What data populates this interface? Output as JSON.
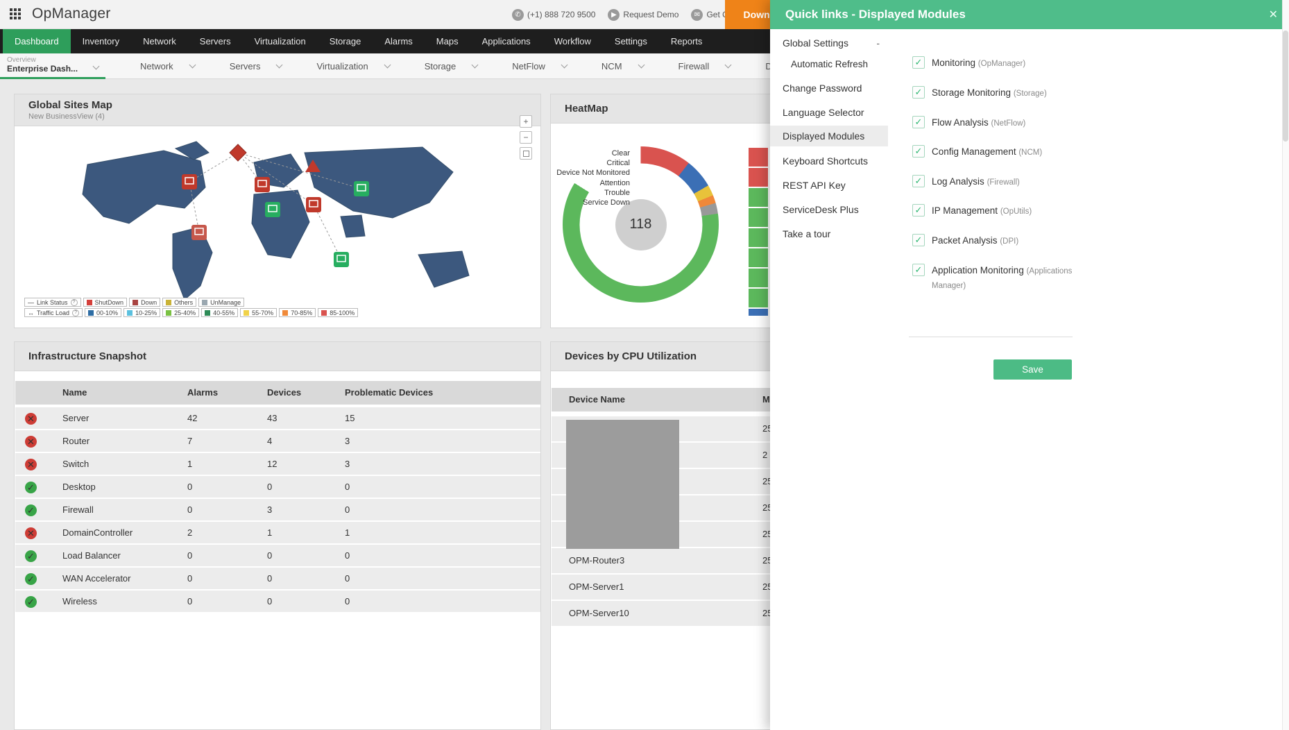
{
  "topbar": {
    "logo": "OpManager",
    "phone": "(+1) 888 720 9500",
    "request_demo": "Request Demo",
    "get_quote": "Get Quote",
    "download_label": "Download"
  },
  "nav": {
    "items": [
      {
        "label": "Dashboard"
      },
      {
        "label": "Inventory"
      },
      {
        "label": "Network"
      },
      {
        "label": "Servers"
      },
      {
        "label": "Virtualization"
      },
      {
        "label": "Storage"
      },
      {
        "label": "Alarms"
      },
      {
        "label": "Maps"
      },
      {
        "label": "Applications"
      },
      {
        "label": "Workflow"
      },
      {
        "label": "Settings"
      },
      {
        "label": "Reports"
      }
    ]
  },
  "subnav": {
    "overview": "Overview",
    "dashboard_name": "Enterprise Dash...",
    "items": [
      "Network",
      "Servers",
      "Virtualization",
      "Storage",
      "NetFlow",
      "NCM",
      "Firewall",
      "DPI"
    ]
  },
  "map_card": {
    "title": "Global Sites Map",
    "subtitle": "New BusinessView (4)",
    "zoom_in": "+",
    "zoom_out": "−",
    "help": "?",
    "legend": {
      "link_status": "Link Status",
      "link_symbol": "—",
      "traffic_symbol": "↔",
      "link_items": [
        {
          "label": "ShutDown",
          "color": "#d43f3a"
        },
        {
          "label": "Down",
          "color": "#a94442"
        },
        {
          "label": "Others",
          "color": "#c9b237"
        },
        {
          "label": "UnManage",
          "color": "#9aa7b0"
        }
      ],
      "traffic_load": "Traffic Load",
      "traffic_items": [
        {
          "label": "00-10%",
          "color": "#2e6da4"
        },
        {
          "label": "10-25%",
          "color": "#5bc0de"
        },
        {
          "label": "25-40%",
          "color": "#7ac143"
        },
        {
          "label": "40-55%",
          "color": "#2e8b57"
        },
        {
          "label": "55-70%",
          "color": "#f0d24a"
        },
        {
          "label": "70-85%",
          "color": "#f08a3a"
        },
        {
          "label": "85-100%",
          "color": "#d9534f"
        }
      ]
    }
  },
  "heatmap_card": {
    "title": "HeatMap",
    "center_value": "118",
    "chart_data": {
      "type": "pie",
      "labels": [
        "Clear",
        "Critical",
        "Device Not Monitored",
        "Attention",
        "Trouble",
        "Service Down"
      ],
      "approx_percent": [
        75,
        11,
        6,
        2,
        2,
        2
      ],
      "colors": [
        "#5cb85c",
        "#d9534f",
        "#3b6fb5",
        "#e8c23a",
        "#f0883a",
        "#999999"
      ],
      "total": 118
    },
    "cells": [
      "#d9534f",
      "#d9534f",
      "#5cb85c",
      "#5cb85c",
      "#5cb85c",
      "#5cb85c",
      "#5cb85c",
      "#5cb85c",
      "#3b6fb5"
    ]
  },
  "infra_card": {
    "title": "Infrastructure Snapshot",
    "columns": [
      "Name",
      "Alarms",
      "Devices",
      "Problematic Devices"
    ],
    "rows": [
      {
        "status": "error",
        "name": "Server",
        "alarms": "42",
        "devices": "43",
        "problematic": "15"
      },
      {
        "status": "error",
        "name": "Router",
        "alarms": "7",
        "devices": "4",
        "problematic": "3"
      },
      {
        "status": "error",
        "name": "Switch",
        "alarms": "1",
        "devices": "12",
        "problematic": "3"
      },
      {
        "status": "ok",
        "name": "Desktop",
        "alarms": "0",
        "devices": "0",
        "problematic": "0"
      },
      {
        "status": "ok",
        "name": "Firewall",
        "alarms": "0",
        "devices": "3",
        "problematic": "0"
      },
      {
        "status": "error",
        "name": "DomainController",
        "alarms": "2",
        "devices": "1",
        "problematic": "1"
      },
      {
        "status": "ok",
        "name": "Load Balancer",
        "alarms": "0",
        "devices": "0",
        "problematic": "0"
      },
      {
        "status": "ok",
        "name": "WAN Accelerator",
        "alarms": "0",
        "devices": "0",
        "problematic": "0"
      },
      {
        "status": "ok",
        "name": "Wireless",
        "alarms": "0",
        "devices": "0",
        "problematic": "0"
      }
    ]
  },
  "cpu_card": {
    "title": "Devices by CPU Utilization",
    "columns": [
      "Device Name",
      "M"
    ],
    "rows": [
      {
        "name": "",
        "value": "25"
      },
      {
        "name": "",
        "value": "2"
      },
      {
        "name": "",
        "value": "25"
      },
      {
        "name": "",
        "value": "25"
      },
      {
        "name": "",
        "value": "25"
      },
      {
        "name": "OPM-Router3",
        "value": "25"
      },
      {
        "name": "OPM-Server1",
        "value": "25"
      },
      {
        "name": "OPM-Server10",
        "value": "25"
      }
    ]
  },
  "quicklinks": {
    "title": "Quick links - Displayed Modules",
    "close": "✕",
    "menu": [
      {
        "label": "Global Settings",
        "suffix": "-"
      },
      {
        "label": "Automatic Refresh"
      },
      {
        "label": "Change Password"
      },
      {
        "label": "Language Selector"
      },
      {
        "label": "Displayed Modules"
      },
      {
        "label": "Keyboard Shortcuts"
      },
      {
        "label": "REST API Key"
      },
      {
        "label": "ServiceDesk Plus"
      },
      {
        "label": "Take a tour"
      }
    ],
    "modules": [
      {
        "name": "Monitoring",
        "suffix": "(OpManager)",
        "checked": true
      },
      {
        "name": "Storage Monitoring",
        "suffix": "(Storage)",
        "checked": true
      },
      {
        "name": "Flow Analysis",
        "suffix": "(NetFlow)",
        "checked": true
      },
      {
        "name": "Config Management",
        "suffix": "(NCM)",
        "checked": true
      },
      {
        "name": "Log Analysis",
        "suffix": "(Firewall)",
        "checked": true
      },
      {
        "name": "IP Management",
        "suffix": "(OpUtils)",
        "checked": true
      },
      {
        "name": "Packet Analysis",
        "suffix": "(DPI)",
        "checked": true
      },
      {
        "name": "Application Monitoring",
        "suffix": "(Applications Manager)",
        "checked": true
      }
    ],
    "check_glyph": "✓",
    "save_label": "Save"
  }
}
